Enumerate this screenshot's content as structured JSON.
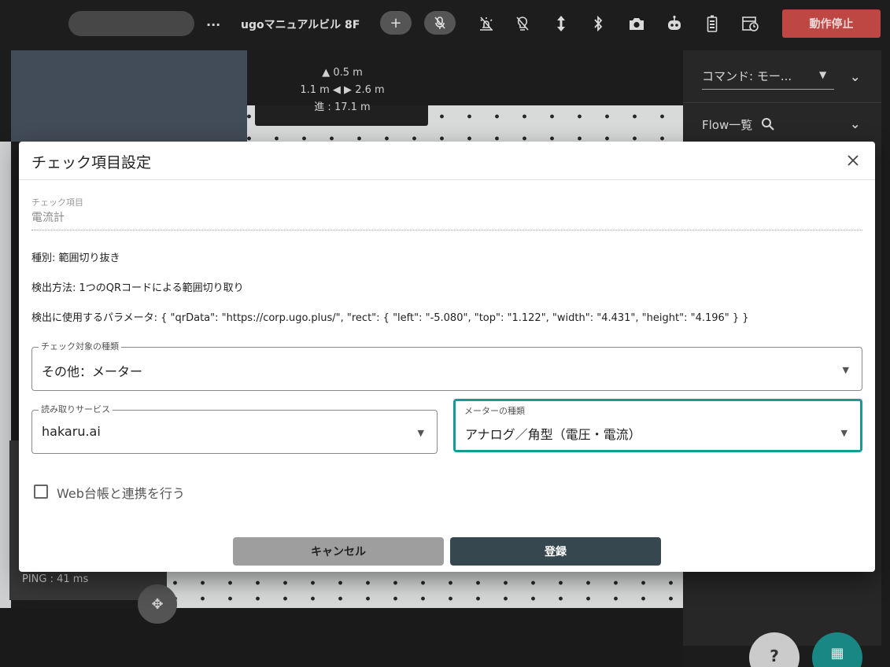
{
  "header": {
    "more": "...",
    "location": "ugoマニュアルビル 8F",
    "stop_label": "動作停止",
    "icons": [
      "add-lock-icon",
      "mic-off-icon",
      "light-off-icon",
      "bulb-off-icon",
      "vertical-arrows-icon",
      "bluetooth-icon",
      "camera-icon",
      "robot-icon",
      "battery-icon",
      "schedule-icon"
    ]
  },
  "overlay": {
    "height": "▲ 0.5 m",
    "lr": "1.1 m ◀ ▶ 2.6 m",
    "forward": "進 : 17.1 m",
    "ping": "PING : 41 ms"
  },
  "right_panel": {
    "command": "コマンド: モー...",
    "flow": "Flow一覧"
  },
  "dialog": {
    "title": "チェック項目設定",
    "check_item_label": "チェック項目",
    "check_item_value": "電流計",
    "kind": "種別: 範囲切り抜き",
    "method": "検出方法: 1つのQRコードによる範囲切り取り",
    "params": "検出に使用するパラメータ: { \"qrData\": \"https://corp.ugo.plus/\", \"rect\": { \"left\": \"-5.080\", \"top\": \"1.122\", \"width\": \"4.431\", \"height\": \"4.196\" } }",
    "target_type_label": "チェック対象の種類",
    "target_type_value": "その他：メーター",
    "service_label": "読み取りサービス",
    "service_value": "hakaru.ai",
    "meter_type_label": "メーターの種類",
    "meter_type_value": "アナログ／角型（電圧・電流）",
    "web_link_label": "Web台帳と連携を行う",
    "cancel_label": "キャンセル",
    "submit_label": "登録"
  },
  "colors": {
    "accent": "#1a9a96",
    "stop": "#c94b47",
    "submit": "#37474f"
  }
}
